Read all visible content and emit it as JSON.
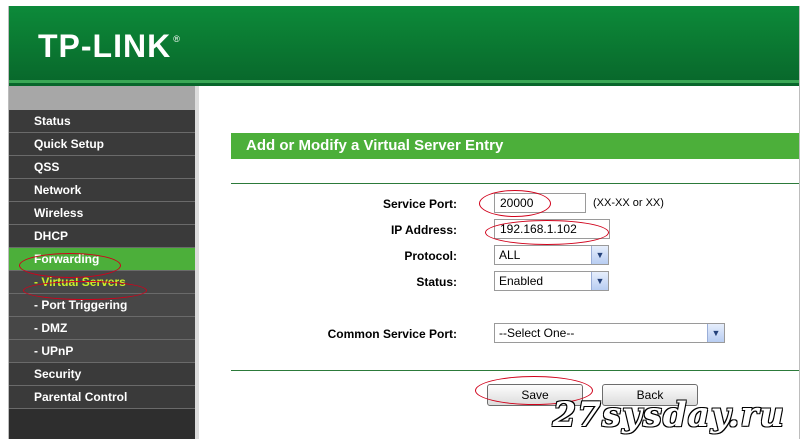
{
  "brand": {
    "logo_text": "TP-LINK",
    "trademark": "®"
  },
  "sidebar": {
    "items": [
      {
        "label": "Status"
      },
      {
        "label": "Quick Setup"
      },
      {
        "label": "QSS"
      },
      {
        "label": "Network"
      },
      {
        "label": "Wireless"
      },
      {
        "label": "DHCP"
      },
      {
        "label": "Forwarding"
      },
      {
        "label": "- Virtual Servers"
      },
      {
        "label": "- Port Triggering"
      },
      {
        "label": "- DMZ"
      },
      {
        "label": "- UPnP"
      },
      {
        "label": "Security"
      },
      {
        "label": "Parental Control"
      }
    ]
  },
  "form": {
    "title": "Add or Modify a Virtual Server Entry",
    "service_port": {
      "label": "Service Port:",
      "value": "20000",
      "hint": "(XX-XX or XX)"
    },
    "ip_address": {
      "label": "IP Address:",
      "value": "192.168.1.102"
    },
    "protocol": {
      "label": "Protocol:",
      "value": "ALL"
    },
    "status": {
      "label": "Status:",
      "value": "Enabled"
    },
    "common_service_port": {
      "label": "Common Service Port:",
      "value": "--Select One--"
    },
    "save_label": "Save",
    "back_label": "Back"
  },
  "watermark": "27sysday.ru",
  "colors": {
    "header_green": "#0b7c33",
    "accent_green": "#4caf3a",
    "annotation_red": "#d0021b",
    "sidebar_dark": "#3a3a3a"
  }
}
